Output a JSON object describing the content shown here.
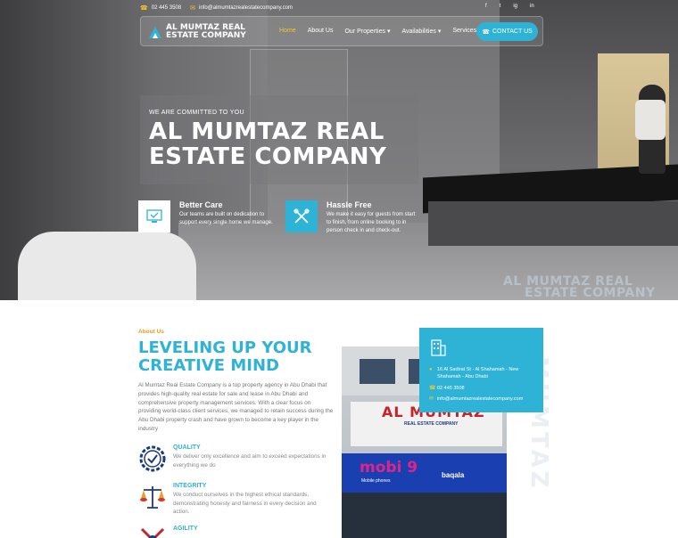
{
  "topbar": {
    "phone": "02 445 3508",
    "email": "info@almumtazrealestatecompany.com",
    "socials": [
      "f",
      "t",
      "ig",
      "in"
    ]
  },
  "logo": {
    "line1": "AL MUMTAZ REAL",
    "line2": "ESTATE COMPANY"
  },
  "nav": {
    "items": [
      {
        "label": "Home",
        "active": true
      },
      {
        "label": "About Us"
      },
      {
        "label": "Our Properties",
        "caret": true
      },
      {
        "label": "Availabilities",
        "caret": true
      },
      {
        "label": "Services"
      }
    ],
    "contact_button": "CONTACT US"
  },
  "hero": {
    "eyebrow": "WE ARE COMMITTED TO YOU",
    "title": "AL MUMTAZ REAL ESTATE COMPANY",
    "watermark_line1": "AL MUMTAZ REAL",
    "watermark_line2": "ESTATE COMPANY",
    "features": [
      {
        "title": "Better Care",
        "desc": "Our teams are built on dedication to support every single home we manage."
      },
      {
        "title": "Hassle Free",
        "desc": "We make it easy for guests from start to finish, from online booking to in person check in and check-out."
      }
    ]
  },
  "about": {
    "eyebrow": "About Us",
    "title": "LEVELING UP YOUR CREATIVE MIND",
    "desc": "Al Mumtaz Real Estate Company is a top property agency in Abu Dhabi that provides high-quality real estate for sale and lease in Abu Dhabi and comprehensive property management services. With a clear focus on providing world-class client services, we managed to retain success during the Abu Dhabi property crash and have grown to become a key player in the industry",
    "values": [
      {
        "title": "QUALITY",
        "desc": "We deliver only excellence and aim to exceed expectations in everything we do"
      },
      {
        "title": "INTEGRITY",
        "desc": "We conduct ourselves in the highest ethical standards, demonstrating honesty and fairness in every decision and action."
      },
      {
        "title": "AGILITY",
        "desc": ""
      }
    ],
    "vertical_text": "MUMTAZ"
  },
  "building_sign": {
    "name": "AL MUMTAZ",
    "sub": "REAL ESTATE COMPANY",
    "mobi": "mobi 9",
    "mobi_sub": "Mobile phones",
    "baqala": "baqala"
  },
  "contact_card": {
    "address": "16 Al Sadirat St - Al Shahamah - New Shahamah - Abu Dhabi",
    "phone": "02 445 3508",
    "email": "info@almumtazrealestatecompany.com"
  },
  "colors": {
    "accent": "#2eb2d6",
    "gold": "#f4c430",
    "orange": "#e8a020"
  }
}
